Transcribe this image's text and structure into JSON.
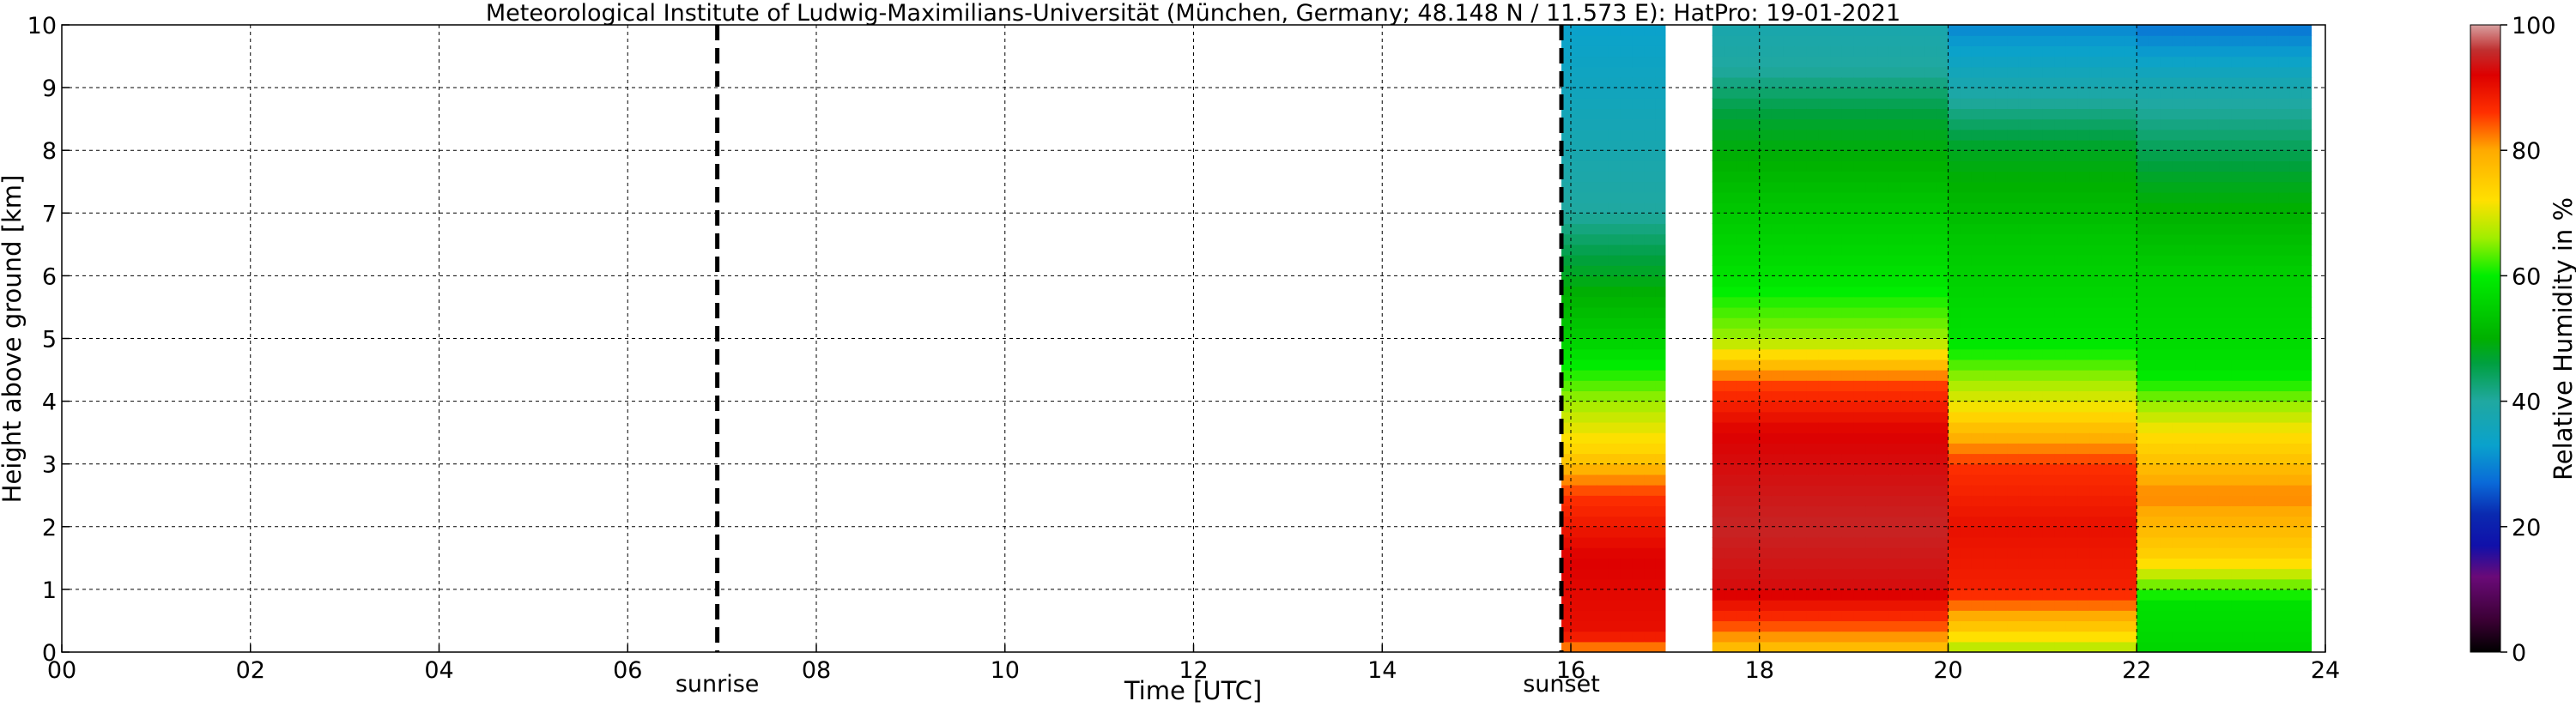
{
  "chart_data": {
    "type": "heatmap",
    "title": "Meteorological Institute of Ludwig-Maximilians-Universität (München, Germany; 48.148 N / 11.573 E):    HatPro: 19-01-2021",
    "xlabel": "Time [UTC]",
    "ylabel": "Height above ground [km]",
    "xlim": [
      0,
      24
    ],
    "ylim": [
      0,
      10
    ],
    "x_ticks": [
      "00",
      "02",
      "04",
      "06",
      "08",
      "10",
      "12",
      "14",
      "16",
      "18",
      "20",
      "22",
      "24"
    ],
    "x_tick_values": [
      0,
      2,
      4,
      6,
      8,
      10,
      12,
      14,
      16,
      18,
      20,
      22,
      24
    ],
    "y_ticks": [
      "0",
      "1",
      "2",
      "3",
      "4",
      "5",
      "6",
      "7",
      "8",
      "9",
      "10"
    ],
    "y_tick_values": [
      0,
      1,
      2,
      3,
      4,
      5,
      6,
      7,
      8,
      9,
      10
    ],
    "grid": true,
    "annotations": [
      {
        "label": "sunrise",
        "x": 6.95
      },
      {
        "label": "sunset",
        "x": 15.9
      }
    ],
    "colorbar": {
      "label": "Relative Humidity in %",
      "range": [
        0,
        100
      ],
      "ticks": [
        "0",
        "20",
        "40",
        "60",
        "80",
        "100"
      ],
      "tick_values": [
        0,
        20,
        40,
        60,
        80,
        100
      ],
      "stops": [
        {
          "value": 0,
          "color": "#000000"
        },
        {
          "value": 5,
          "color": "#3a0033"
        },
        {
          "value": 12,
          "color": "#6a0a78"
        },
        {
          "value": 17,
          "color": "#1010aa"
        },
        {
          "value": 22,
          "color": "#0a2ab0"
        },
        {
          "value": 27,
          "color": "#0a6ad8"
        },
        {
          "value": 33,
          "color": "#0aa2cc"
        },
        {
          "value": 40,
          "color": "#20a8a0"
        },
        {
          "value": 46,
          "color": "#00a040"
        },
        {
          "value": 50,
          "color": "#00b000"
        },
        {
          "value": 60,
          "color": "#00ee00"
        },
        {
          "value": 66,
          "color": "#a0ee00"
        },
        {
          "value": 72,
          "color": "#ffe000"
        },
        {
          "value": 80,
          "color": "#ffaa00"
        },
        {
          "value": 86,
          "color": "#ff3000"
        },
        {
          "value": 92,
          "color": "#dd0000"
        },
        {
          "value": 96,
          "color": "#c03030"
        },
        {
          "value": 100,
          "color": "#d8a0a0"
        }
      ]
    },
    "data_segments": [
      {
        "t_start": 15.9,
        "t_end": 17.0,
        "profile": [
          {
            "h": 0.0,
            "rh": 80
          },
          {
            "h": 0.3,
            "rh": 90
          },
          {
            "h": 1.5,
            "rh": 92
          },
          {
            "h": 2.5,
            "rh": 86
          },
          {
            "h": 3.2,
            "rh": 74
          },
          {
            "h": 4.0,
            "rh": 66
          },
          {
            "h": 5.0,
            "rh": 55
          },
          {
            "h": 6.3,
            "rh": 46
          },
          {
            "h": 7.0,
            "rh": 40
          },
          {
            "h": 10.0,
            "rh": 33
          }
        ]
      },
      {
        "t_start": 17.5,
        "t_end": 20.0,
        "profile": [
          {
            "h": 0.0,
            "rh": 76
          },
          {
            "h": 0.5,
            "rh": 86
          },
          {
            "h": 1.0,
            "rh": 93
          },
          {
            "h": 2.0,
            "rh": 95
          },
          {
            "h": 3.5,
            "rh": 92
          },
          {
            "h": 4.3,
            "rh": 85
          },
          {
            "h": 5.0,
            "rh": 66
          },
          {
            "h": 6.0,
            "rh": 58
          },
          {
            "h": 7.0,
            "rh": 54
          },
          {
            "h": 8.5,
            "rh": 47
          },
          {
            "h": 9.3,
            "rh": 40
          },
          {
            "h": 10.0,
            "rh": 38
          }
        ]
      },
      {
        "t_start": 20.0,
        "t_end": 22.0,
        "profile": [
          {
            "h": 0.0,
            "rh": 66
          },
          {
            "h": 0.5,
            "rh": 78
          },
          {
            "h": 1.0,
            "rh": 88
          },
          {
            "h": 2.0,
            "rh": 90
          },
          {
            "h": 3.0,
            "rh": 86
          },
          {
            "h": 4.0,
            "rh": 70
          },
          {
            "h": 5.0,
            "rh": 58
          },
          {
            "h": 6.5,
            "rh": 54
          },
          {
            "h": 8.0,
            "rh": 48
          },
          {
            "h": 9.0,
            "rh": 38
          },
          {
            "h": 10.0,
            "rh": 30
          }
        ]
      },
      {
        "t_start": 22.0,
        "t_end": 23.85,
        "profile": [
          {
            "h": 0.0,
            "rh": 56
          },
          {
            "h": 0.8,
            "rh": 58
          },
          {
            "h": 1.5,
            "rh": 74
          },
          {
            "h": 2.5,
            "rh": 82
          },
          {
            "h": 3.5,
            "rh": 72
          },
          {
            "h": 4.5,
            "rh": 58
          },
          {
            "h": 6.0,
            "rh": 55
          },
          {
            "h": 7.5,
            "rh": 48
          },
          {
            "h": 9.0,
            "rh": 38
          },
          {
            "h": 10.0,
            "rh": 28
          }
        ]
      }
    ],
    "missing_intervals": [
      [
        17.0,
        17.5
      ]
    ]
  }
}
